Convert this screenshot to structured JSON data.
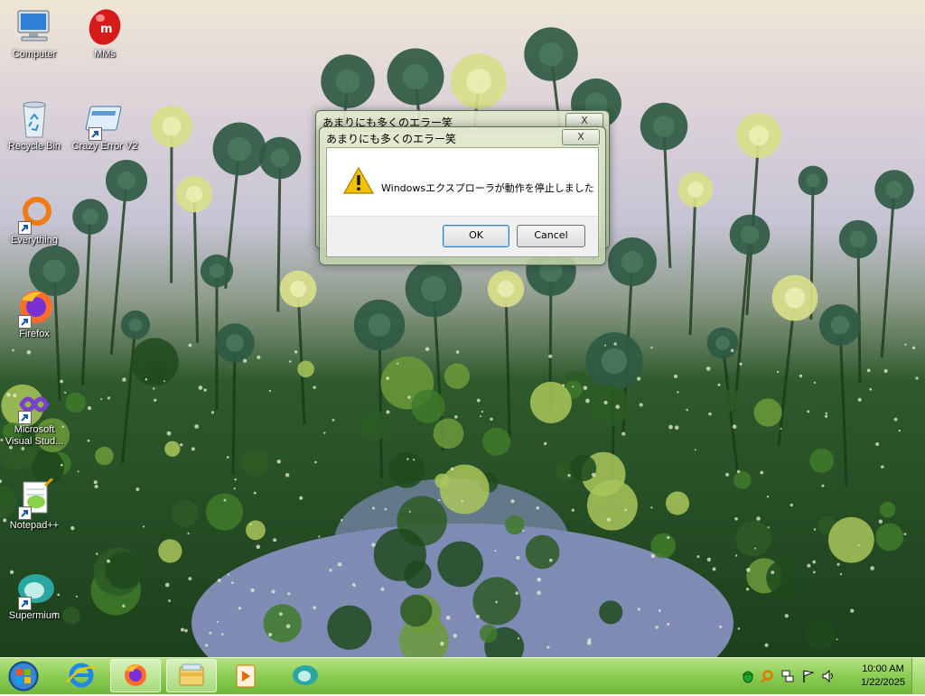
{
  "desktop_icons": [
    {
      "label": "Computer",
      "icon": "computer-icon",
      "shortcut": false
    },
    {
      "label": "MMs",
      "icon": "mms-icon",
      "shortcut": false
    },
    {
      "label": "Recycle Bin",
      "icon": "recycle-bin-icon",
      "shortcut": false
    },
    {
      "label": "Crazy Error V2",
      "icon": "crazy-error-icon",
      "shortcut": true
    },
    {
      "label": "Everything",
      "icon": "everything-search-icon",
      "shortcut": true
    },
    {
      "label": "Firefox",
      "icon": "firefox-icon",
      "shortcut": true
    },
    {
      "label": "Microsoft Visual Stud...",
      "icon": "visual-studio-icon",
      "shortcut": true
    },
    {
      "label": "Notepad++",
      "icon": "notepad-plus-plus-icon",
      "shortcut": true
    },
    {
      "label": "Supermium",
      "icon": "supermium-icon",
      "shortcut": true
    }
  ],
  "dialog_back": {
    "title": "あまりにも多くのエラー笑",
    "close_label": "X"
  },
  "dialog": {
    "title": "あまりにも多くのエラー笑",
    "close_label": "X",
    "message": "Windowsエクスプローラが動作を停止しました",
    "icon": "warning-icon",
    "ok_label": "OK",
    "cancel_label": "Cancel"
  },
  "taskbar": {
    "start": "start-button-icon",
    "pinned": [
      {
        "name": "internet-explorer-icon",
        "active": false
      },
      {
        "name": "firefox-icon",
        "active": true
      },
      {
        "name": "file-explorer-icon",
        "active": true
      },
      {
        "name": "media-player-icon",
        "active": false
      },
      {
        "name": "supermium-icon",
        "active": false
      }
    ]
  },
  "tray": {
    "icons": [
      "bug-tray-icon",
      "search-tray-icon",
      "network-icon",
      "flag-icon",
      "volume-icon"
    ],
    "time": "10:00 AM",
    "date": "1/22/2025"
  },
  "colors": {
    "taskbar": "#8fcf56",
    "warning": "#f3c200",
    "default_button_border": "#3c7fb1"
  }
}
